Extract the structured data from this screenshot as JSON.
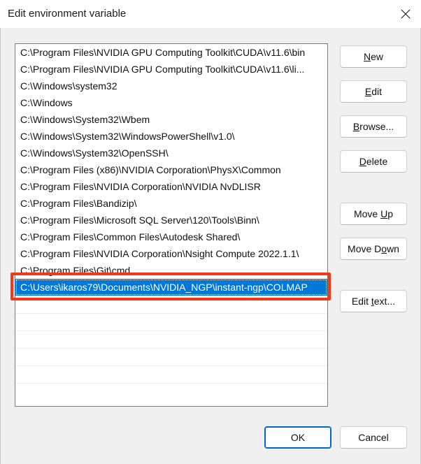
{
  "window": {
    "title": "Edit environment variable"
  },
  "paths": [
    "C:\\Program Files\\NVIDIA GPU Computing Toolkit\\CUDA\\v11.6\\bin",
    "C:\\Program Files\\NVIDIA GPU Computing Toolkit\\CUDA\\v11.6\\li...",
    "C:\\Windows\\system32",
    "C:\\Windows",
    "C:\\Windows\\System32\\Wbem",
    "C:\\Windows\\System32\\WindowsPowerShell\\v1.0\\",
    "C:\\Windows\\System32\\OpenSSH\\",
    "C:\\Program Files (x86)\\NVIDIA Corporation\\PhysX\\Common",
    "C:\\Program Files\\NVIDIA Corporation\\NVIDIA NvDLISR",
    "C:\\Program Files\\Bandizip\\",
    "C:\\Program Files\\Microsoft SQL Server\\120\\Tools\\Binn\\",
    "C:\\Program Files\\Common Files\\Autodesk Shared\\",
    "C:\\Program Files\\NVIDIA Corporation\\Nsight Compute 2022.1.1\\",
    "C:\\Program Files\\Git\\cmd",
    "C:\\Users\\ikaros79\\Documents\\NVIDIA_NGP\\instant-ngp\\COLMAP"
  ],
  "selected_index": 14,
  "buttons": {
    "new": {
      "pre": "",
      "key": "N",
      "post": "ew"
    },
    "edit": {
      "pre": "",
      "key": "E",
      "post": "dit"
    },
    "browse": {
      "pre": "",
      "key": "B",
      "post": "rowse..."
    },
    "delete": {
      "pre": "",
      "key": "D",
      "post": "elete"
    },
    "move_up": {
      "pre": "Move ",
      "key": "U",
      "post": "p"
    },
    "move_down": {
      "pre": "Move D",
      "key": "o",
      "post": "wn"
    },
    "edit_text": {
      "pre": "Edit ",
      "key": "t",
      "post": "ext..."
    },
    "ok": "OK",
    "cancel": "Cancel"
  },
  "colors": {
    "selection": "#0078d7",
    "annotation": "#f03a17"
  },
  "icons": {
    "close": "close-icon"
  }
}
